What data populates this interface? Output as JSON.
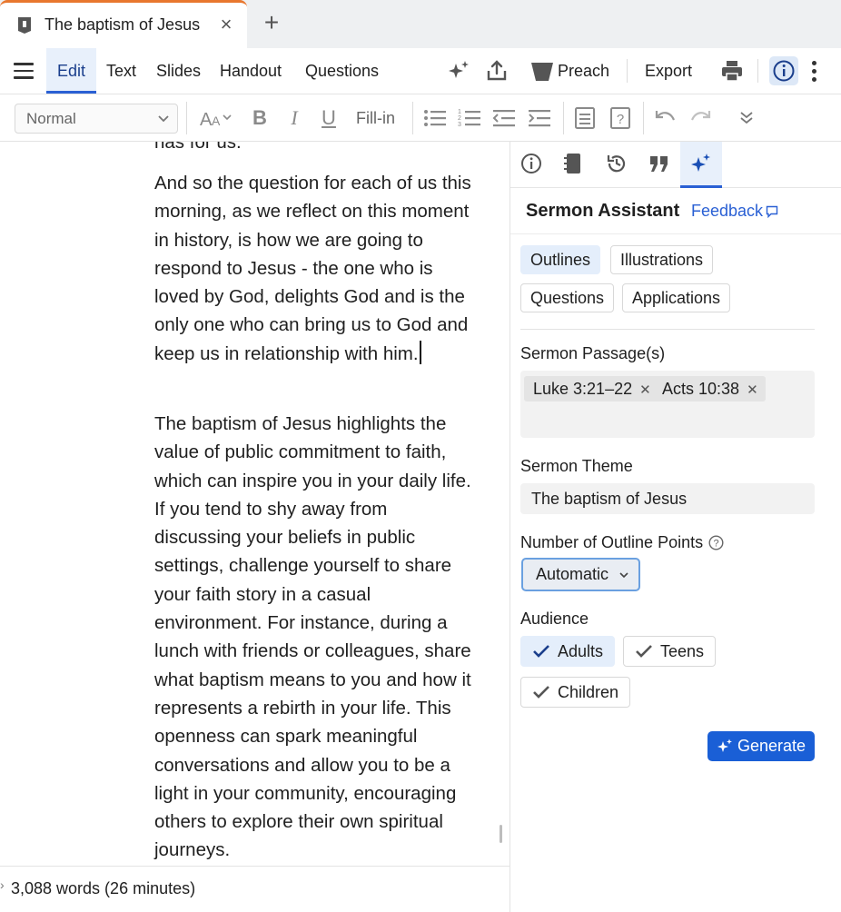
{
  "tab": {
    "title": "The baptism of Jesus",
    "close": "×",
    "add": "+"
  },
  "menu": {
    "items": [
      "Edit",
      "Text",
      "Slides",
      "Handout",
      "Questions"
    ],
    "preach": "Preach",
    "export": "Export"
  },
  "format": {
    "style_value": "Normal",
    "fill_in": "Fill-in",
    "bold": "B",
    "italic": "I",
    "underline": "U"
  },
  "editor": {
    "paragraph_cut": "has for us.",
    "paragraph_1": "And so the question for each of us this morning, as we reflect on this moment in history, is how we are going to respond to Jesus - the one who is loved by God, delights God and is the only one who can bring us to God and keep us in relationship with him.",
    "paragraph_2": "The baptism of Jesus highlights the value of public commitment to faith, which can inspire you in your daily life. If you tend to shy away from discussing your beliefs in public settings, challenge yourself to share your faith story in a casual environment. For instance, during a lunch with friends or colleagues, share what baptism means to you and how it represents a rebirth in your life. This openness can spark meaningful conversations and allow you to be a light in your community, encouraging others to explore their own spiritual journeys."
  },
  "status": {
    "word_count": "3,088 words (26 minutes)"
  },
  "panel": {
    "title": "Sermon Assistant",
    "feedback": "Feedback",
    "modes": [
      "Outlines",
      "Illustrations",
      "Questions",
      "Applications"
    ],
    "active_mode": "Outlines",
    "passage_label": "Sermon Passage(s)",
    "passages": [
      "Luke 3:21–22",
      "Acts 10:38"
    ],
    "theme_label": "Sermon Theme",
    "theme_value": "The baptism of Jesus",
    "points_label": "Number of Outline Points",
    "points_value": "Automatic",
    "audience_label": "Audience",
    "audiences": [
      "Adults",
      "Teens",
      "Children"
    ],
    "generate": "Generate"
  },
  "colors": {
    "accent": "#2a60d4",
    "tab_accent": "#e8772e",
    "generate_bg": "#1a5fd6",
    "active_bg": "#e4eefb"
  },
  "icons": {
    "panel_tabs": [
      "info-icon",
      "notebook-icon",
      "history-icon",
      "quote-icon",
      "sparkle-icon"
    ]
  }
}
